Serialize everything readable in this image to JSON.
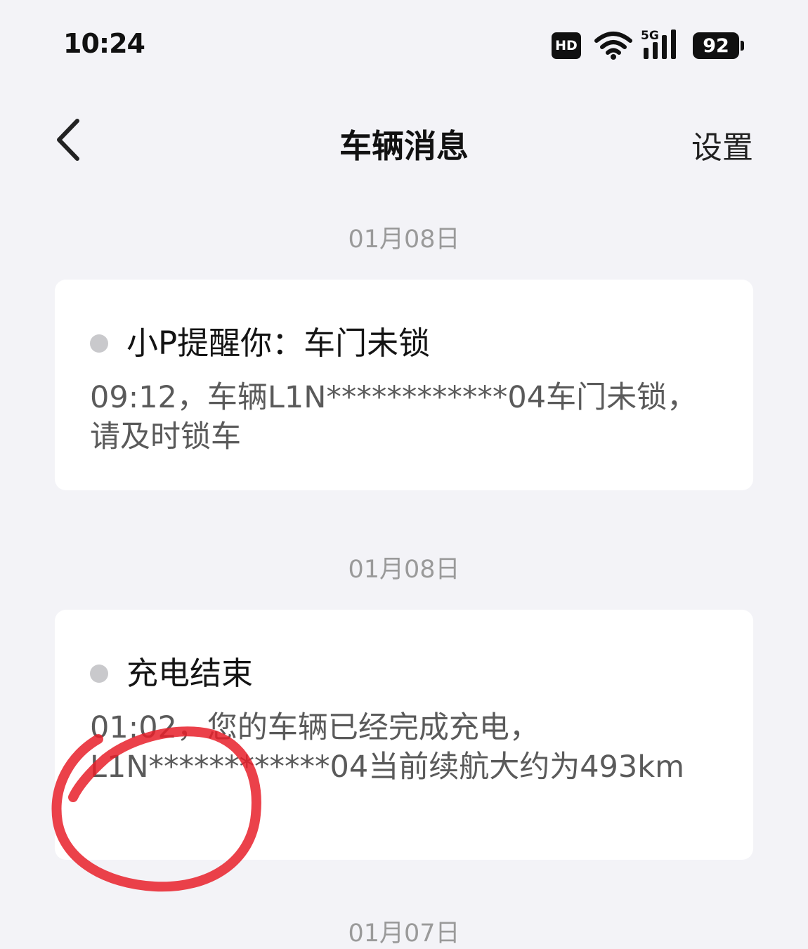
{
  "status_bar": {
    "time": "10:24",
    "hd_label": "HD",
    "network_label": "5G",
    "battery_level": "92",
    "icons": [
      "wifi-icon",
      "cellular-signal-icon",
      "battery-icon"
    ]
  },
  "header": {
    "title": "车辆消息",
    "settings_label": "设置",
    "back_icon": "chevron-left-icon"
  },
  "messages": [
    {
      "date": "01月08日",
      "title": "小P提醒你：车门未锁",
      "body": "09:12，车辆L1N************04车门未锁，请及时锁车"
    },
    {
      "date": "01月08日",
      "title": "充电结束",
      "body": "01:02，您的车辆已经完成充电，L1N************04当前续航大约为493km"
    },
    {
      "date": "01月07日"
    }
  ],
  "annotation": {
    "type": "hand-drawn-circle",
    "color": "#e8202a",
    "target": "493km"
  }
}
